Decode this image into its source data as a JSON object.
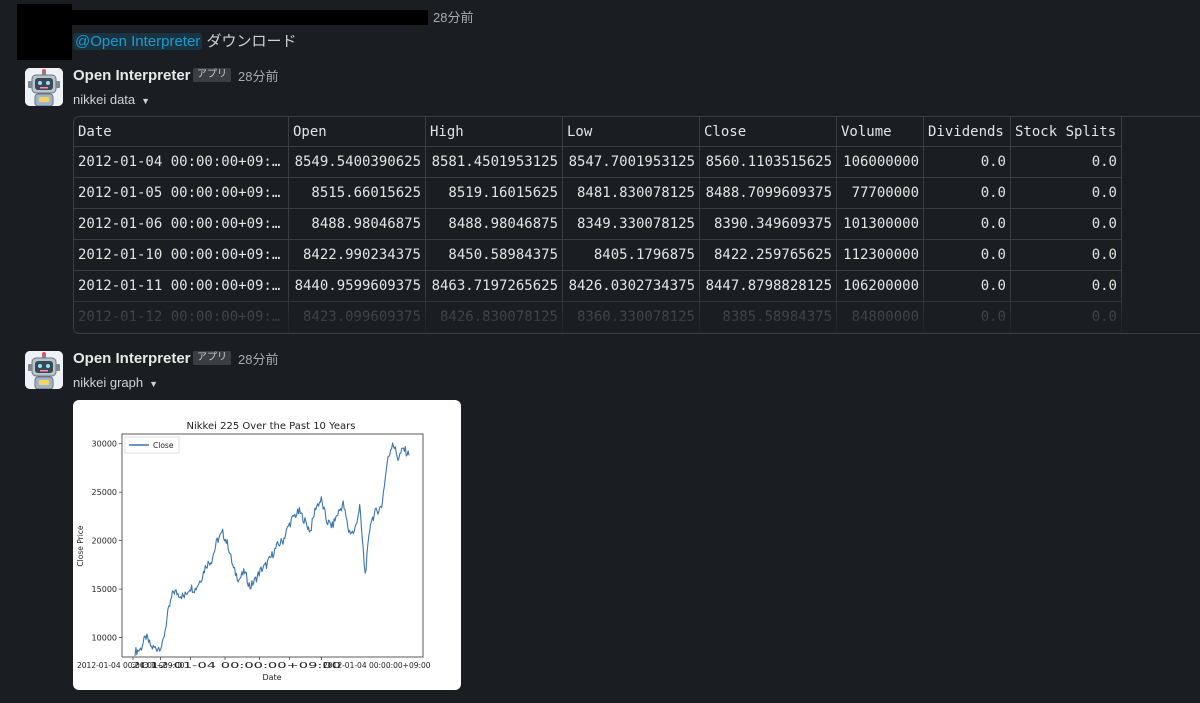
{
  "user_message": {
    "time": "28分前",
    "mention": "@Open Interpreter",
    "text": "ダウンロード"
  },
  "bot_messages": [
    {
      "name": "Open Interpreter",
      "badge": "アプリ",
      "time": "28分前",
      "file_title": "nikkei data"
    },
    {
      "name": "Open Interpreter",
      "badge": "アプリ",
      "time": "28分前",
      "file_title": "nikkei graph"
    }
  ],
  "table": {
    "columns": [
      "Date",
      "Open",
      "High",
      "Low",
      "Close",
      "Volume",
      "Dividends",
      "Stock Splits"
    ],
    "rows": [
      [
        "2012-01-04 00:00:00+09:…",
        "8549.5400390625",
        "8581.4501953125",
        "8547.7001953125",
        "8560.1103515625",
        "106000000",
        "0.0",
        "0.0"
      ],
      [
        "2012-01-05 00:00:00+09:…",
        "8515.66015625",
        "8519.16015625",
        "8481.830078125",
        "8488.7099609375",
        "77700000",
        "0.0",
        "0.0"
      ],
      [
        "2012-01-06 00:00:00+09:…",
        "8488.98046875",
        "8488.98046875",
        "8349.330078125",
        "8390.349609375",
        "101300000",
        "0.0",
        "0.0"
      ],
      [
        "2012-01-10 00:00:00+09:…",
        "8422.990234375",
        "8450.58984375",
        "8405.1796875",
        "8422.259765625",
        "112300000",
        "0.0",
        "0.0"
      ],
      [
        "2012-01-11 00:00:00+09:…",
        "8440.9599609375",
        "8463.7197265625",
        "8426.0302734375",
        "8447.8798828125",
        "106200000",
        "0.0",
        "0.0"
      ],
      [
        "2012-01-12 00:00:00+09:…",
        "8423.099609375",
        "8426.830078125",
        "8360.330078125",
        "8385.58984375",
        "84800000",
        "0.0",
        "0.0"
      ]
    ]
  },
  "chart_data": {
    "type": "line",
    "title": "Nikkei 225 Over the Past 10 Years",
    "xlabel": "Date",
    "ylabel": "Close Price",
    "legend": "top-left",
    "series": [
      {
        "name": "Close",
        "color": "#3a75b0",
        "x": [
          0,
          0.2,
          0.4,
          0.6,
          0.8,
          1.0,
          1.2,
          1.4,
          1.6,
          1.8,
          2.0,
          2.2,
          2.4,
          2.6,
          2.8,
          3.0,
          3.2,
          3.4,
          3.6,
          3.8,
          4.0,
          4.2,
          4.4,
          4.6,
          4.8,
          5.0,
          5.2,
          5.4,
          5.6,
          5.8,
          6.0,
          6.2,
          6.4,
          6.6,
          6.8,
          7.0,
          7.2,
          7.4,
          7.6,
          7.8,
          8.0,
          8.2,
          8.4,
          8.6,
          8.8,
          9.0,
          9.2,
          9.4,
          9.6,
          9.8,
          10.0
        ],
        "values": [
          8560,
          8800,
          10100,
          9000,
          8900,
          9200,
          12500,
          14800,
          14500,
          14200,
          15200,
          15000,
          16000,
          17500,
          18000,
          20000,
          20800,
          19500,
          17000,
          16000,
          16800,
          15200,
          16000,
          17000,
          17500,
          18500,
          19500,
          20000,
          21500,
          22500,
          23000,
          22000,
          21000,
          23500,
          24200,
          22000,
          21500,
          22800,
          23800,
          21000,
          20800,
          23500,
          16500,
          22000,
          23000,
          23500,
          28000,
          30200,
          28500,
          29500,
          28800
        ]
      }
    ],
    "ylim": [
      8000,
      31000
    ],
    "yticks": [
      "30000",
      "25000",
      "20000",
      "15000",
      "10000"
    ],
    "xtick_text": "2012-01-04 00:00:00+09:00"
  }
}
